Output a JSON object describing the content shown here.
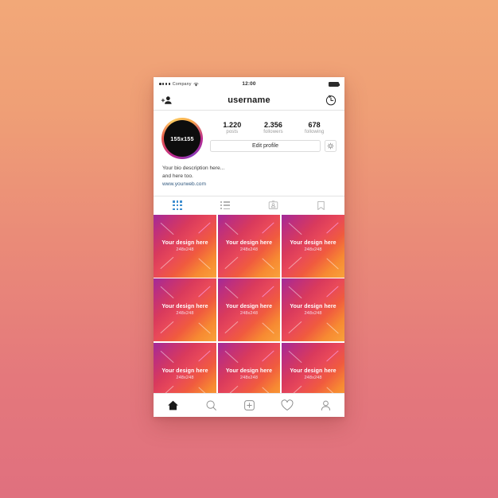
{
  "background": {
    "top_color": "#f2a878",
    "bottom_color": "#e0707e"
  },
  "status_bar": {
    "signal_icon": "signal-dots-icon",
    "carrier": "Company",
    "wifi_icon": "wifi-icon",
    "time": "12:00",
    "battery_icon": "battery-icon"
  },
  "nav_bar": {
    "add_person_icon": "add-person-icon",
    "title": "username",
    "history_icon": "clock-history-icon"
  },
  "profile": {
    "avatar": {
      "label": "155x155",
      "ring_icon": "story-ring-icon"
    },
    "stats": [
      {
        "value": "1.220",
        "label": "posts"
      },
      {
        "value": "2.356",
        "label": "followers"
      },
      {
        "value": "678",
        "label": "following"
      }
    ],
    "edit_button": "Edit profile",
    "settings_icon": "gear-icon",
    "bio": {
      "line1": "Your bio description here...",
      "line2": "and here too.",
      "website": "www.yourweb.com",
      "link_color": "#31597f"
    }
  },
  "tabs": [
    {
      "name": "grid",
      "icon": "grid-icon",
      "active": true
    },
    {
      "name": "list",
      "icon": "list-icon",
      "active": false
    },
    {
      "name": "tagged",
      "icon": "tagged-icon",
      "active": false
    },
    {
      "name": "saved",
      "icon": "bookmark-icon",
      "active": false
    }
  ],
  "grid": {
    "cells": [
      {
        "title": "Your design here",
        "size": "248x248"
      },
      {
        "title": "Your design here",
        "size": "248x248"
      },
      {
        "title": "Your design here",
        "size": "248x248"
      },
      {
        "title": "Your design here",
        "size": "248x248"
      },
      {
        "title": "Your design here",
        "size": "248x248"
      },
      {
        "title": "Your design here",
        "size": "248x248"
      },
      {
        "title": "Your design here",
        "size": "248x248"
      },
      {
        "title": "Your design here",
        "size": "248x248"
      },
      {
        "title": "Your design here",
        "size": "248x248"
      }
    ]
  },
  "bottom_bar": [
    {
      "name": "home",
      "icon": "home-icon",
      "active": true
    },
    {
      "name": "search",
      "icon": "search-icon",
      "active": false
    },
    {
      "name": "add",
      "icon": "plus-box-icon",
      "active": false
    },
    {
      "name": "likes",
      "icon": "heart-icon",
      "active": false
    },
    {
      "name": "profile",
      "icon": "person-icon",
      "active": false
    }
  ]
}
